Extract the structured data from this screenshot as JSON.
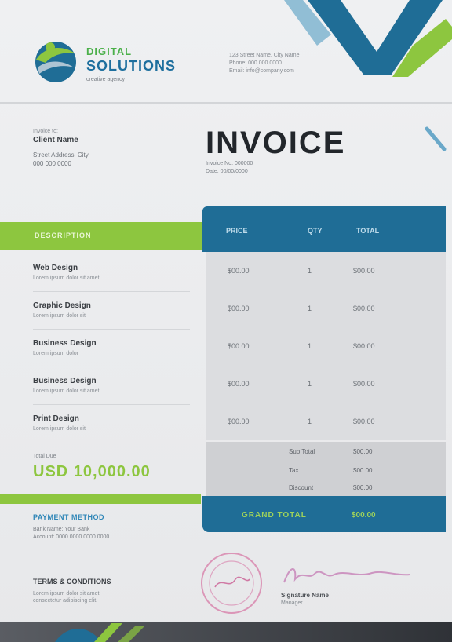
{
  "company": {
    "name_line1": "DIGITAL",
    "name_line2": "SOLUTIONS",
    "tagline": "creative agency",
    "address": [
      "123 Street Name, City Name",
      "Phone: 000 000 0000",
      "Email: info@company.com"
    ]
  },
  "bill_to": {
    "label": "Invoice to:",
    "name": "Client Name",
    "lines": [
      "Street Address, City",
      "000 000 0000"
    ]
  },
  "invoice": {
    "title": "INVOICE",
    "meta": [
      "Invoice No: 000000",
      "Date: 00/00/0000"
    ]
  },
  "table": {
    "item_header": "DESCRIPTION",
    "price_header": "PRICE",
    "qty_header": "QTY",
    "total_header": "TOTAL",
    "rows": [
      {
        "name": "Web Design",
        "desc": "Lorem ipsum dolor sit amet",
        "price": "$00.00",
        "qty": "1",
        "total": "$00.00"
      },
      {
        "name": "Graphic Design",
        "desc": "Lorem ipsum dolor sit",
        "price": "$00.00",
        "qty": "1",
        "total": "$00.00"
      },
      {
        "name": "Business Design",
        "desc": "Lorem ipsum dolor",
        "price": "$00.00",
        "qty": "1",
        "total": "$00.00"
      },
      {
        "name": "Business Design",
        "desc": "Lorem ipsum dolor sit amet",
        "price": "$00.00",
        "qty": "1",
        "total": "$00.00"
      },
      {
        "name": "Print Design",
        "desc": "Lorem ipsum dolor sit",
        "price": "$00.00",
        "qty": "1",
        "total": "$00.00"
      }
    ]
  },
  "totals": {
    "due_label": "Total Due",
    "due_value": "USD 10,000.00",
    "subtotal_label": "Sub Total",
    "subtotal_value": "$00.00",
    "tax_label": "Tax",
    "tax_value": "$00.00",
    "discount_label": "Discount",
    "discount_value": "$00.00",
    "grand_label": "GRAND TOTAL",
    "grand_value": "$00.00"
  },
  "payment": {
    "title": "PAYMENT METHOD",
    "lines": [
      "Bank Name: Your Bank",
      "Account: 0000 0000 0000 0000"
    ]
  },
  "terms": {
    "title": "TERMS & CONDITIONS",
    "lines": [
      "Lorem ipsum dolor sit amet,",
      "consectetur adipiscing elit."
    ]
  },
  "signature": {
    "name": "Signature Name",
    "role": "Manager"
  },
  "colors": {
    "green": "#8dc63f",
    "blue": "#1f6d96",
    "dark": "#22262b"
  }
}
